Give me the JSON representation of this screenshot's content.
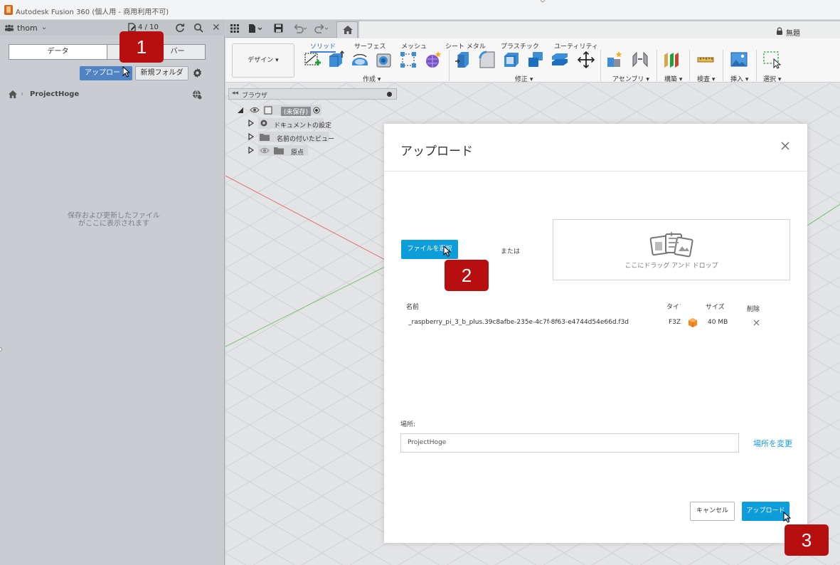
{
  "titlebar": {
    "title": "Autodesk Fusion 360 (個人用 - 商用利用不可)"
  },
  "data_panel": {
    "user": "thom",
    "doc_count": "4 / 10",
    "tabs": [
      {
        "label": "データ",
        "active": true
      },
      {
        "label": "バー",
        "active": false
      }
    ],
    "upload_label": "アップロード",
    "new_folder_label": "新規フォルダ",
    "breadcrumb_project": "ProjectHoge",
    "empty_line1": "保存および更新したファイル",
    "empty_line2": "がここに表示されます"
  },
  "document": {
    "title": "無題"
  },
  "ribbon": {
    "workspace": "デザイン ▾",
    "tabs": [
      {
        "label": "ソリッド",
        "active": true
      },
      {
        "label": "サーフェス",
        "active": false
      },
      {
        "label": "メッシュ",
        "active": false
      },
      {
        "label": "シート メタル",
        "active": false
      },
      {
        "label": "プラスチック",
        "active": false
      },
      {
        "label": "ユーティリティ",
        "active": false
      }
    ],
    "groups": [
      {
        "label": "作成 ▾"
      },
      {
        "label": "修正 ▾"
      },
      {
        "label": "アセンブリ ▾"
      },
      {
        "label": "構築 ▾"
      },
      {
        "label": "検査 ▾"
      },
      {
        "label": "挿入 ▾"
      },
      {
        "label": "選択 ▾"
      }
    ]
  },
  "browser": {
    "title": "ブラウザ",
    "items": [
      {
        "label": "(未保存)"
      },
      {
        "label": "ドキュメントの設定"
      },
      {
        "label": "名前の付いたビュー"
      },
      {
        "label": "原点"
      }
    ]
  },
  "modal": {
    "title": "アップロード",
    "select_file_label": "ファイルを選択",
    "or_text": "または",
    "drop_text": "ここにドラッグ アンド ドロップ",
    "columns": {
      "name": "名前",
      "type": "タイプ",
      "size": "サイズ",
      "remove": "削除"
    },
    "file": {
      "name": "_raspberry_pi_3_b_plus.39c8afbe-235e-4c7f-8f63-e4744d54e66d.f3d",
      "type": "F3Z",
      "size": "40 MB"
    },
    "location_label": "場所:",
    "location_value": "ProjectHoge",
    "change_location_label": "場所を変更",
    "cancel_label": "キャンセル",
    "upload_label": "アップロード"
  },
  "callouts": [
    "1",
    "2",
    "3"
  ],
  "colors": {
    "accent": "#0d9ddb",
    "panel_upload": "#4f83c3",
    "callout": "#b70f0f"
  }
}
